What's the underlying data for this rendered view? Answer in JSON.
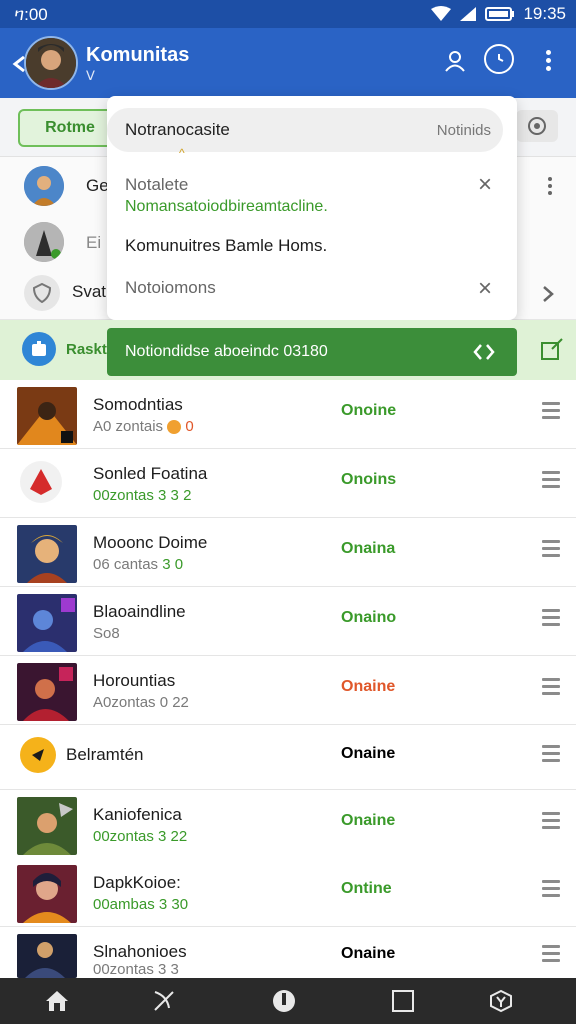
{
  "status_bar": {
    "time_left": "ⴈ:00",
    "time_right": "19:35"
  },
  "header": {
    "title": "Komunitas",
    "subtitle": "ⴸ"
  },
  "tabrow": {
    "pill_label": "Rotme"
  },
  "under_rows": [
    {
      "label": "Ge"
    },
    {
      "label": "Ei"
    },
    {
      "label": "Svat"
    }
  ],
  "popup": {
    "search_placeholder": "Notranocasite",
    "search_right": "Notinids",
    "item1_title": "Notalete",
    "item1_sub": "Nomansatoiodbireamtacline.",
    "item2_title": "Komunuitres Bamle Homs.",
    "item3_title": "Notoiomons"
  },
  "greenbar": {
    "left_label": "Raskt",
    "message": "Notiondidse aboeindc 03180"
  },
  "list": [
    {
      "name": "Somodntias",
      "meta": "A0 zontais",
      "meta2": "0",
      "status": "Onoine",
      "status_color": "#3a9a2a"
    },
    {
      "name": "Sonled Foatina",
      "meta": "00zontas  3 3 2",
      "status": "Onoins",
      "status_color": "#3a9a2a"
    },
    {
      "name": "Mooonc Doime",
      "meta": "06 cantas",
      "meta2": "3 0",
      "status": "Onaina",
      "status_color": "#3a9a2a"
    },
    {
      "name": "Blaoaindline",
      "meta": "So8",
      "status": "Onaino",
      "status_color": "#3a9a2a"
    },
    {
      "name": "Horountias",
      "meta": "A0zontas  0 22",
      "status": "Onaine",
      "status_color": "#e0572a"
    },
    {
      "name": "Belramtén",
      "meta": "",
      "status": "Onaine",
      "status_color": "#3a9a2a"
    },
    {
      "name": "Kaniofenica",
      "meta": "00zontas  3 22",
      "status": "Onaine",
      "status_color": "#3a9a2a"
    },
    {
      "name": "DapkKoioe:",
      "meta": "00ambas  3 30",
      "status": "Ontine",
      "status_color": "#3a9a2a"
    },
    {
      "name": "Slnahonioes",
      "meta": "00zontas  3 3",
      "status": "Onaine",
      "status_color": "#3a9a2a"
    }
  ],
  "colors": {
    "primary": "#2a63c5",
    "statusbar": "#1d4fa6",
    "green": "#3c8e3a",
    "online": "#3a9a2a",
    "away": "#e0572a"
  }
}
